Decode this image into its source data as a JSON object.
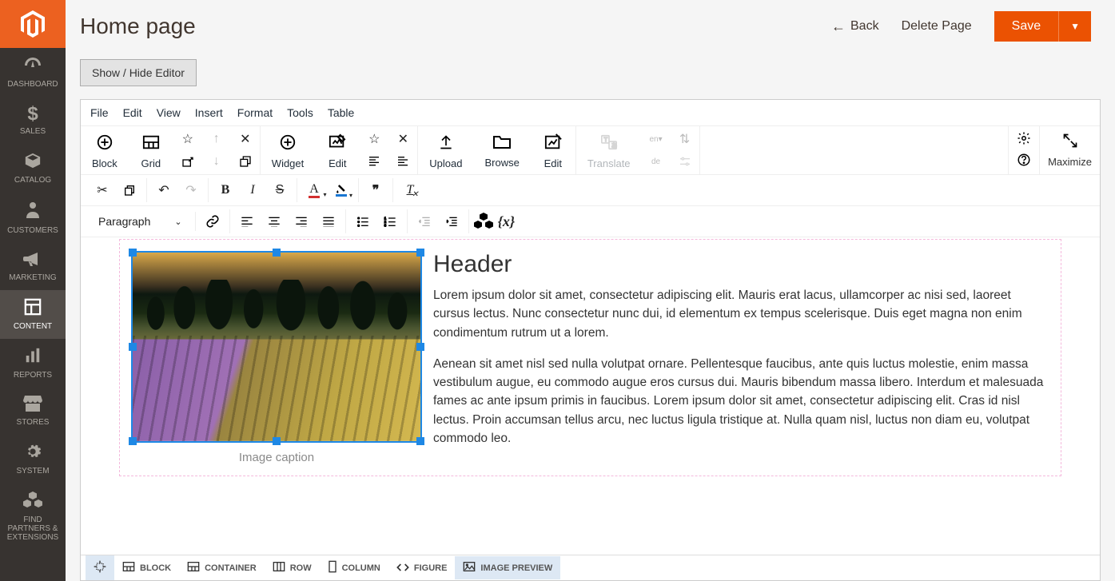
{
  "sidebar": {
    "items": [
      {
        "label": "DASHBOARD",
        "icon": "dashboard"
      },
      {
        "label": "SALES",
        "icon": "dollar"
      },
      {
        "label": "CATALOG",
        "icon": "box"
      },
      {
        "label": "CUSTOMERS",
        "icon": "person"
      },
      {
        "label": "MARKETING",
        "icon": "megaphone"
      },
      {
        "label": "CONTENT",
        "icon": "layout",
        "active": true
      },
      {
        "label": "REPORTS",
        "icon": "bars"
      },
      {
        "label": "STORES",
        "icon": "storefront"
      },
      {
        "label": "SYSTEM",
        "icon": "gear"
      },
      {
        "label": "FIND PARTNERS & EXTENSIONS",
        "icon": "cubes"
      }
    ]
  },
  "header": {
    "title": "Home page",
    "back": "Back",
    "delete": "Delete Page",
    "save": "Save"
  },
  "editor_toggle": "Show / Hide Editor",
  "menu": [
    "File",
    "Edit",
    "View",
    "Insert",
    "Format",
    "Tools",
    "Table"
  ],
  "toolbar1": {
    "block": "Block",
    "grid": "Grid",
    "widget": "Widget",
    "edit": "Edit",
    "upload": "Upload",
    "browse": "Browse",
    "edit2": "Edit",
    "translate": "Translate",
    "maximize": "Maximize",
    "lang1": "en",
    "lang2": "de"
  },
  "toolbar3": {
    "paragraph": "Paragraph"
  },
  "content": {
    "caption": "Image caption",
    "header": "Header",
    "p1": "Lorem ipsum dolor sit amet, consectetur adipiscing elit. Mauris erat lacus, ullamcorper ac nisi sed, laoreet cursus lectus. Nunc consectetur nunc dui, id elementum ex tempus scelerisque. Duis eget magna non enim condimentum rutrum ut a lorem.",
    "p2": "Aenean sit amet nisl sed nulla volutpat ornare. Pellentesque faucibus, ante quis luctus molestie, enim massa vestibulum augue, eu commodo augue eros cursus dui. Mauris bibendum massa libero. Interdum et malesuada fames ac ante ipsum primis in faucibus. Lorem ipsum dolor sit amet, consectetur adipiscing elit. Cras id nisl lectus. Proin accumsan tellus arcu, nec luctus ligula tristique at. Nulla quam nisl, luctus non diam eu, volutpat commodo leo."
  },
  "path": [
    {
      "label": "",
      "icon": "target",
      "sel": true
    },
    {
      "label": "BLOCK",
      "icon": "grid"
    },
    {
      "label": "CONTAINER",
      "icon": "grid"
    },
    {
      "label": "ROW",
      "icon": "row"
    },
    {
      "label": "COLUMN",
      "icon": "col"
    },
    {
      "label": "FIGURE",
      "icon": "code"
    },
    {
      "label": "IMAGE PREVIEW",
      "icon": "image",
      "sel": true
    }
  ]
}
